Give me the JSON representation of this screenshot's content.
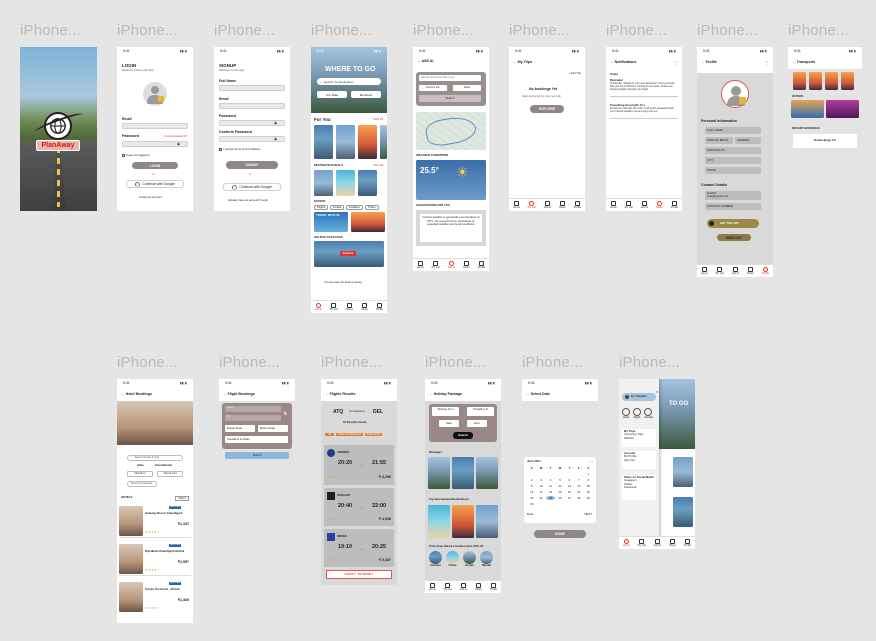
{
  "frame_label": "iPhone...",
  "status_time": "9:41",
  "nav": [
    "Home",
    "My List",
    "Add to",
    "Share",
    "Profile"
  ],
  "splash": {
    "brand": "PlanAway"
  },
  "login": {
    "title": "LOGIN",
    "subtitle": "Welcome back to the App",
    "email_label": "Email",
    "password_label": "Password",
    "forgot": "Forgot password?",
    "keep": "Keep me logged in",
    "submit": "LOGIN",
    "or": "or",
    "google": "Continue with Google",
    "create": "Create an account"
  },
  "signup": {
    "title": "SIGNUP",
    "subtitle": "Welcome to the App",
    "fields": [
      "Full Name",
      "Email",
      "Password",
      "Conform Password"
    ],
    "terms": "I accept terms and Conditions",
    "submit": "SIGNUP",
    "or": "or",
    "google": "Continue with Google",
    "have": "Already have an account? Login"
  },
  "home": {
    "hero_title": "WHERE TO GO",
    "search_placeholder": "Search for Destination",
    "when": "Any Date",
    "who": "Members",
    "for_you": "For You",
    "view_all": "View All",
    "destinations": "DESTINATION DEALS",
    "offers": "OFFERS",
    "offer_chips": [
      "Flights",
      "Hotels",
      "Holidays",
      "Trains"
    ],
    "offer_banner": "TRAVEL WITH US",
    "holiday": "HOLIDAY PACKAGES",
    "explore": "Explore",
    "footer": "You are here for better journey"
  },
  "ai": {
    "title": "ASK AI",
    "q_placeholder": "Where would you like to go",
    "from": "Current loc.",
    "to": "Dest",
    "go": "Go",
    "search": "Search",
    "weather": "WEATHER CONDITIONS",
    "temp": "25.5°",
    "suggestions": "SUGGESTIONS FOR YOU",
    "suggestion_text": "Current weather is good with a temperature of 25°C. It's a good time to visit based on expected weather and local conditions."
  },
  "trips": {
    "title": "My Trips",
    "add": "+ Add Trip",
    "empty": "No bookings Yet",
    "empty_sub": "Start exploring for your next trip",
    "explore": "EXPLORE"
  },
  "notif": {
    "title": "Notifications",
    "today": "Today",
    "items": [
      {
        "head": "Reminder",
        "text": "Hi Traveller ! Ready for your next adventure? Just a reminder that your trip to Shimla is coming up next week. Check your booking details and pack your bags!"
      },
      {
        "head": "Something Good with You",
        "text": "Escape the cold with 20% OFF on all beach getaways! Book your tropical vacation now and enjoy the sun."
      }
    ]
  },
  "profile": {
    "title": "Profile",
    "personal": "Personal Information",
    "fields": [
      "FULL NAME",
      "DATE OF BIRTH",
      "GENDER",
      "NATIONALITY",
      "CITY",
      "STATE"
    ],
    "contact": "Contact Details",
    "email_label": "Email ID",
    "email": "user@gmail.com",
    "phone": "CONTACT NUMBER",
    "toggle": "GET THE APP",
    "signout": "SIGN OUT"
  },
  "transports": {
    "title": "Transports",
    "offers": "OFFERS",
    "recent": "RECENT BOOKINGS",
    "no_book": "No Bookings Yet"
  },
  "hotel": {
    "title": "Hotel Bookings",
    "search": "Search Hotel & City",
    "tab1": "India",
    "tab2": "International",
    "checkin": "Check In",
    "checkout": "Check Out",
    "rooms": "Rooms & Guests",
    "hotels": "HOTELS",
    "filter": "Filters",
    "list": [
      {
        "name": "Gateway Resort Chandigarh",
        "price": "₹1,347",
        "tag": "Best Deal"
      },
      {
        "name": "Wyndham Chandigarh Mohali",
        "price": "₹1,557",
        "tag": "Best Deal"
      },
      {
        "name": "Treebo Orchestra - Mohali",
        "price": "₹1,469",
        "tag": "Best Deal"
      }
    ]
  },
  "flight": {
    "title": "Flight Bookings",
    "from": "From",
    "to": "To",
    "depart": "Depart Date",
    "return": "Return Date",
    "travellers": "Travellers & Class",
    "search": "Search"
  },
  "results": {
    "title": "Flights Results",
    "from_code": "ATQ",
    "to_code": "DEL",
    "date": "On Selected",
    "count": "18 Results Found",
    "chips": [
      "All",
      "NON-STOP/Direct",
      "EARLIEST"
    ],
    "flights": [
      {
        "air": "AIRINDIA",
        "dep": "20:20",
        "arr": "21:55",
        "price": "₹ 3,296"
      },
      {
        "air": "SPICEJET",
        "dep": "20:40",
        "arr": "22:00",
        "price": "₹ 4,938"
      },
      {
        "air": "INDIGO",
        "dep": "19:10",
        "arr": "20:25",
        "price": "₹ 5,487"
      }
    ],
    "happy": "HAPPY JOURNEY"
  },
  "holiday": {
    "title": "Holiday Package",
    "starting": "Starting from",
    "travelling": "Travelling To",
    "start": "Start",
    "end": "End",
    "search": "Search",
    "packages": "Packages",
    "top": "Top International Destinations",
    "deal": "Price Drop Saloni Limetime Upto 30% off",
    "cities": [
      "Istanbul",
      "Oman",
      "Kerala",
      "Manali"
    ]
  },
  "date": {
    "title": "Select Date",
    "month": "June 2024",
    "days": [
      "S",
      "M",
      "T",
      "W",
      "T",
      "F",
      "S"
    ],
    "done": "DONE",
    "next": "NEXT",
    "book": "Book"
  },
  "menu": {
    "greeting": "Hi, Traveller",
    "items": [
      "Hotel",
      "Flight",
      "Holiday"
    ],
    "trips": "My Trips",
    "trip_rows": [
      "Upcoming Trips",
      "Wishlist"
    ],
    "account": "Account",
    "acc_rows": [
      "My Profile",
      "Sign Out"
    ],
    "share": "Share on Social Media",
    "socials": [
      "Instagram",
      "Twitter",
      "Facebook"
    ],
    "bg_title": "TO GO"
  }
}
